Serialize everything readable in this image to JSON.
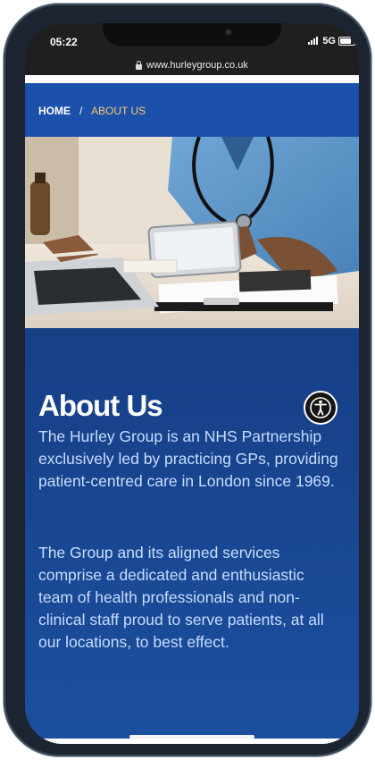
{
  "status_bar": {
    "time": "05:22",
    "network": "5G"
  },
  "browser": {
    "url": "www.hurleygroup.co.uk"
  },
  "breadcrumb": {
    "home": "HOME",
    "separator": "/",
    "current": "ABOUT US"
  },
  "hero_image": {
    "alt": "Doctor with stethoscope using a tablet beside a laptop and clipboard"
  },
  "main": {
    "title": "About Us",
    "paragraph1": "The Hurley Group is an NHS Partnership exclusively led by practicing GPs, providing patient-centred care in London since 1969.",
    "paragraph2": "The Group and its aligned services comprise a dedicated and enthusiastic team of health professionals and non-clinical staff proud to serve patients, at all our locations, to best effect."
  },
  "accessibility_button": {
    "icon": "accessibility-icon"
  },
  "colors": {
    "brand_blue": "#1c51ab",
    "breadcrumb_active": "#f5c96f",
    "text": "#c8ddff"
  }
}
